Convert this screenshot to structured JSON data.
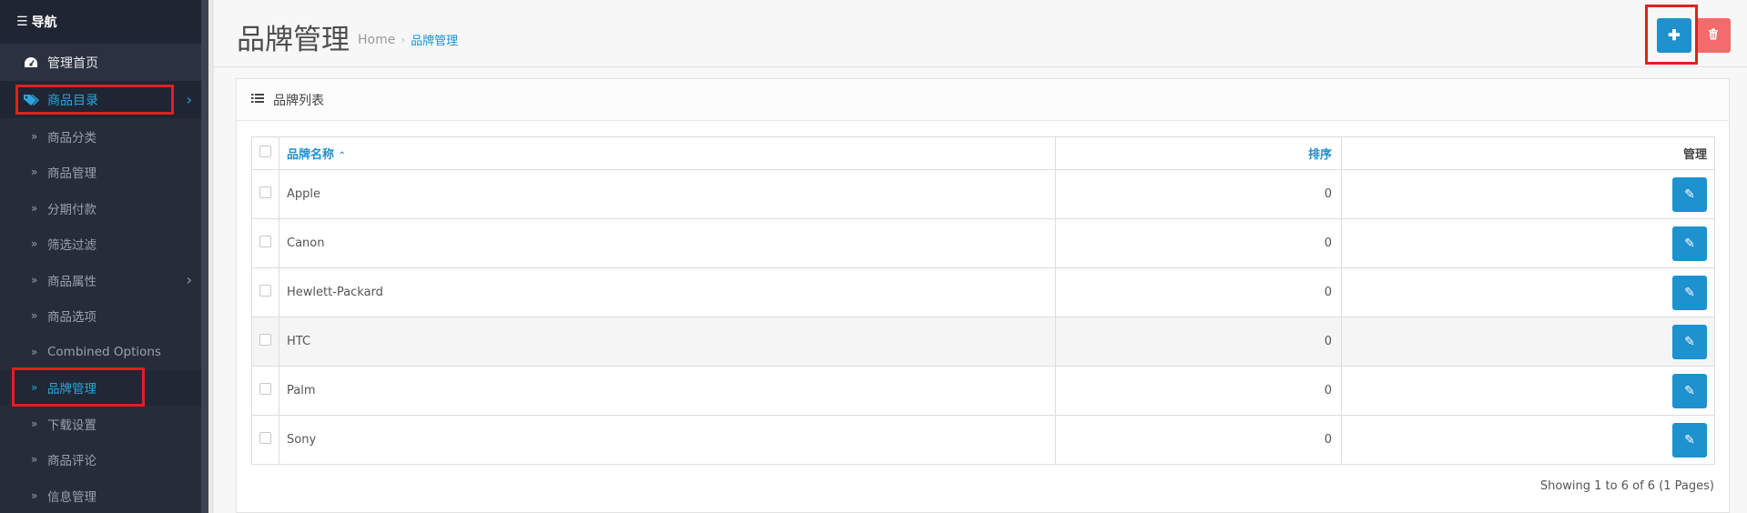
{
  "sidebar": {
    "header": "导航",
    "items": [
      {
        "label": "管理首页",
        "icon": "dashboard-icon"
      },
      {
        "label": "商品目录",
        "icon": "tags-icon",
        "open": true
      }
    ],
    "sub_items": [
      {
        "label": "商品分类"
      },
      {
        "label": "商品管理"
      },
      {
        "label": "分期付款"
      },
      {
        "label": "筛选过滤"
      },
      {
        "label": "商品属性"
      },
      {
        "label": "商品选项"
      },
      {
        "label": "Combined Options"
      },
      {
        "label": "品牌管理",
        "active": true
      },
      {
        "label": "下载设置"
      },
      {
        "label": "商品评论"
      },
      {
        "label": "信息管理"
      }
    ]
  },
  "header": {
    "title": "品牌管理",
    "breadcrumb": [
      "Home",
      "品牌管理"
    ],
    "add_icon": "plus-icon",
    "delete_icon": "trash-icon"
  },
  "panel": {
    "title": "品牌列表",
    "columns": {
      "name": "品牌名称",
      "sort": "排序",
      "action": "管理"
    },
    "rows": [
      {
        "name": "Apple",
        "sort": "0"
      },
      {
        "name": "Canon",
        "sort": "0"
      },
      {
        "name": "Hewlett-Packard",
        "sort": "0"
      },
      {
        "name": "HTC",
        "sort": "0"
      },
      {
        "name": "Palm",
        "sort": "0"
      },
      {
        "name": "Sony",
        "sort": "0"
      }
    ],
    "pagination_text": "Showing 1 to 6 of 6 (1 Pages)"
  },
  "colors": {
    "primary": "#1e91cf",
    "danger": "#f56b6b",
    "sidebar_bg": "#2a3140",
    "highlight": "#e02020"
  }
}
